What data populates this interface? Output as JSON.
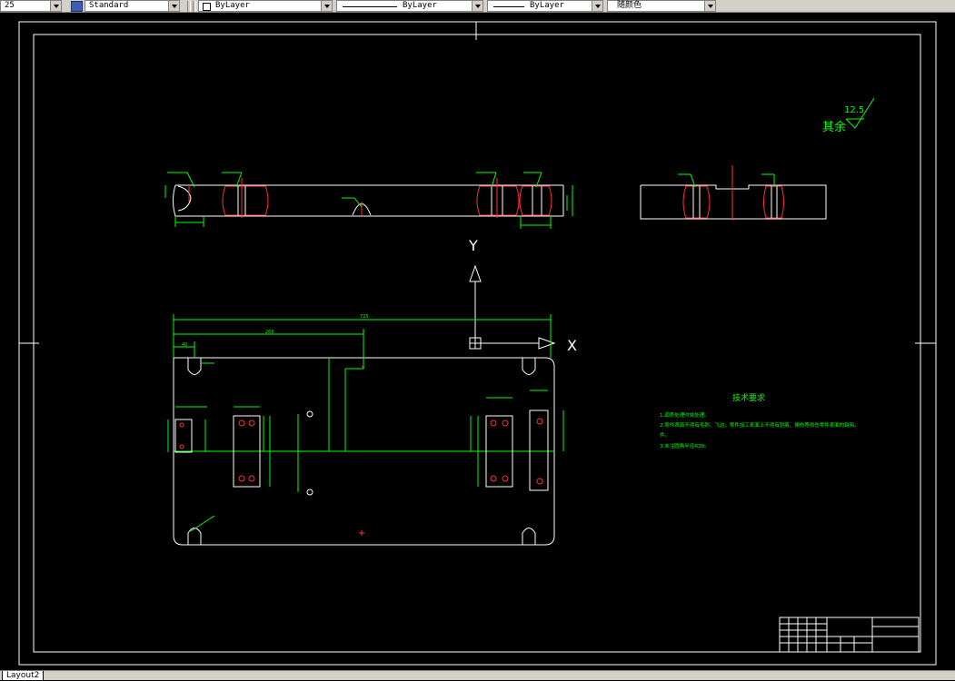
{
  "toolbar": {
    "scale_value": "25",
    "text_style": "Standard",
    "layer_color": "ByLayer",
    "linetype": "ByLayer",
    "lineweight": "ByLayer",
    "plot_style": "随颜色"
  },
  "drawing": {
    "roughness_value": "12.5",
    "roughness_label": "其余",
    "tech_req_title": "技术要求",
    "tech_req_items": [
      "1.调质处理时效处理。",
      "2.零件表面不得有毛刺、飞边，零件加工表面上不得有划痕、擦伤等损伤零件表面的缺陷。",
      "件。",
      "3.未注圆角半径R20。"
    ],
    "dim_overall_width": "725",
    "dim_offset": "266",
    "dim_left": "40",
    "ucs_y": "Y",
    "ucs_x": "X"
  },
  "layout_tab": "Layout2"
}
